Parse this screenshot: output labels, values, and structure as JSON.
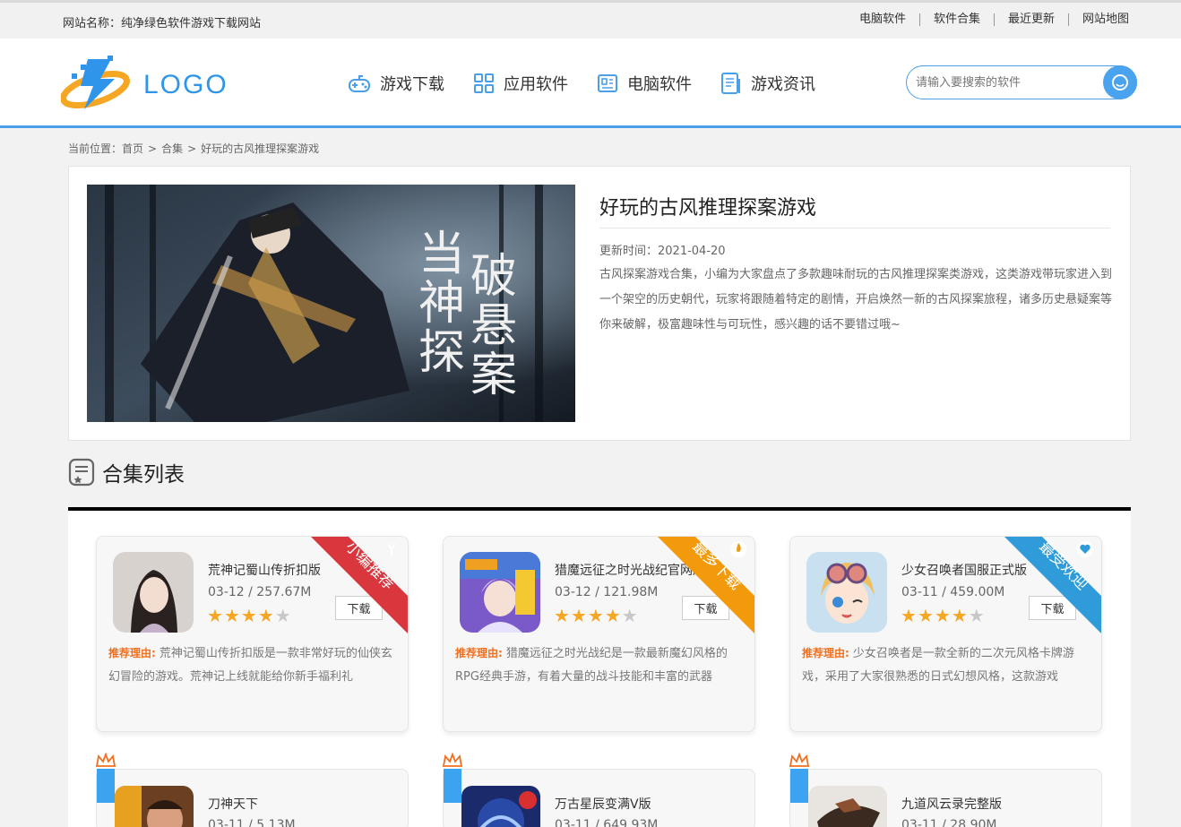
{
  "topbar": {
    "site_name": "网站名称：纯净绿色软件游戏下载网站",
    "links": [
      "电脑软件",
      "软件合集",
      "最近更新",
      "网站地图"
    ]
  },
  "header": {
    "logo_text": "LOGO",
    "nav": [
      {
        "label": "游戏下载",
        "icon": "gamepad-icon"
      },
      {
        "label": "应用软件",
        "icon": "apps-grid-icon"
      },
      {
        "label": "电脑软件",
        "icon": "computer-icon"
      },
      {
        "label": "游戏资讯",
        "icon": "news-icon"
      }
    ],
    "search_placeholder": "请输入要搜索的软件"
  },
  "breadcrumb": {
    "prefix": "当前位置：",
    "items": [
      "首页",
      "合集",
      "好玩的古风推理探案游戏"
    ]
  },
  "intro": {
    "title": "好玩的古风推理探案游戏",
    "date": "更新时间：2021-04-20",
    "desc": "古风探案游戏合集，小编为大家盘点了多款趣味耐玩的古风推理探案类游戏，这类游戏带玩家进入到一个架空的历史朝代，玩家将跟随着特定的剧情，开启焕然一新的古风探案旅程，诸多历史悬疑案等你来破解，极富趣味性与可玩性，感兴趣的话不要错过哦~",
    "banner_text": [
      "当",
      "神",
      "探",
      "破",
      "悬",
      "案"
    ]
  },
  "section": {
    "title": "合集列表"
  },
  "cards": [
    {
      "name": "荒神记蜀山传折扣版",
      "meta": "03-12 / 257.67M",
      "rating": 4,
      "download": "下载",
      "reason_label": "推荐理由:",
      "reason": "荒神记蜀山传折扣版是一款非常好玩的仙侠玄幻冒险的游戏。荒神记上线就能给你新手福利礼",
      "ribbon": "小编推荐",
      "ribbon_color": "#d9363e"
    },
    {
      "name": "猎魔远征之时光战纪官网版",
      "meta": "03-12 / 121.98M",
      "rating": 4,
      "download": "下载",
      "reason_label": "推荐理由:",
      "reason": "猎魔远征之时光战纪是一款最新魔幻风格的RPG经典手游，有着大量的战斗技能和丰富的武器",
      "ribbon": "最多下载",
      "ribbon_color": "#f39a0c"
    },
    {
      "name": "少女召唤者国服正式版",
      "meta": "03-11 / 459.00M",
      "rating": 4,
      "download": "下载",
      "reason_label": "推荐理由:",
      "reason": "少女召唤者是一款全新的二次元风格卡牌游戏，采用了大家很熟悉的日式幻想风格，这款游戏",
      "ribbon": "最受欢迎",
      "ribbon_color": "#2f9bd8"
    }
  ],
  "cards_row2": [
    {
      "name": "刀神天下",
      "meta": "03-11 / 5.13M"
    },
    {
      "name": "万古星辰变满V版",
      "meta": "03-11 / 649.93M"
    },
    {
      "name": "九道风云录完整版",
      "meta": "03-11 / 28.90M"
    }
  ],
  "colors": {
    "accent": "#4a9fe8",
    "orange": "#f07020",
    "star": "#f5a623"
  }
}
